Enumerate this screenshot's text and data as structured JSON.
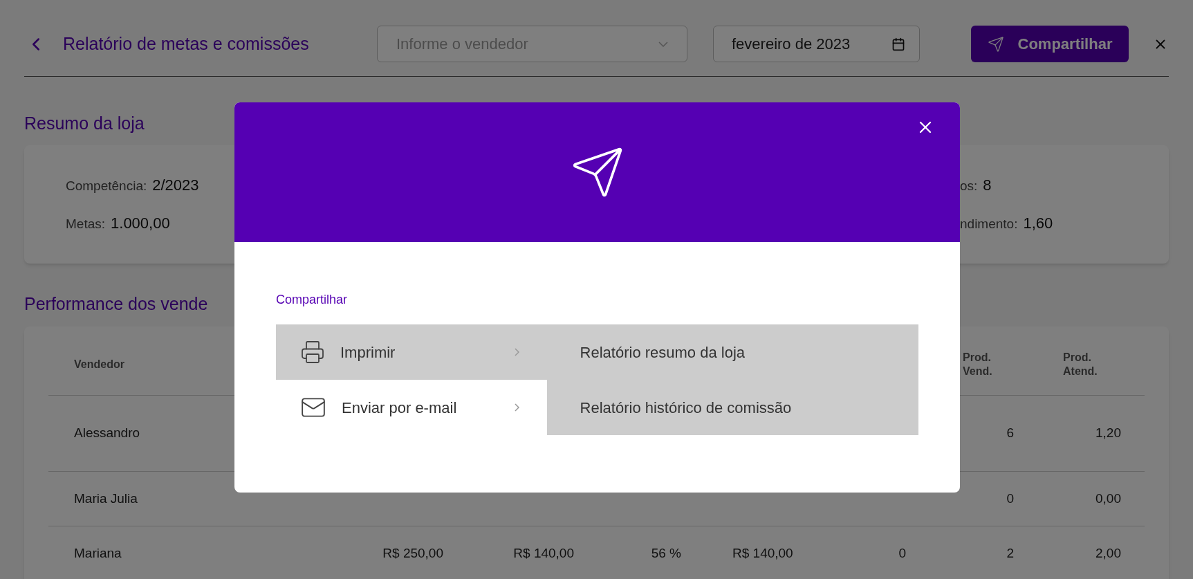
{
  "header": {
    "title": "Relatório de metas e comissões",
    "seller_select": {
      "placeholder": "Informe o vendedor"
    },
    "month_field": {
      "value": "fevereiro de 2023"
    },
    "share_button": "Compartilhar"
  },
  "store_summary": {
    "title": "Resumo da loja",
    "fields": [
      {
        "label": "Competência:",
        "value": "2/2023"
      },
      {
        "label": "os:",
        "value": "8"
      },
      {
        "label": "Metas:",
        "value": "1.000,00"
      },
      {
        "label": "ndimento:",
        "value": "1,60"
      }
    ]
  },
  "performance": {
    "title": "Performance dos vende",
    "columns": [
      {
        "label": "Vendedor"
      },
      {
        "label": "Prod. Vend."
      },
      {
        "label": "Prod. Atend."
      }
    ],
    "rows": [
      {
        "vendedor": "Alessandro",
        "cells": [
          null,
          null,
          null,
          null,
          null,
          "6",
          "1,20"
        ]
      },
      {
        "vendedor": "Maria Julia",
        "cells": [
          null,
          null,
          null,
          null,
          null,
          "0",
          "0,00"
        ]
      },
      {
        "vendedor": "Mariana",
        "cells": [
          "R$ 250,00",
          "R$ 140,00",
          "56 %",
          "R$ 140,00",
          "0",
          "2",
          "2,00"
        ]
      }
    ]
  },
  "share_dialog": {
    "label": "Compartilhar",
    "options": [
      {
        "kind": "print",
        "label": "Imprimir",
        "selected": true
      },
      {
        "kind": "email",
        "label": "Enviar por e-mail",
        "selected": false
      }
    ],
    "reports": [
      "Relatório resumo da loja",
      "Relatório histórico de comissão"
    ]
  }
}
